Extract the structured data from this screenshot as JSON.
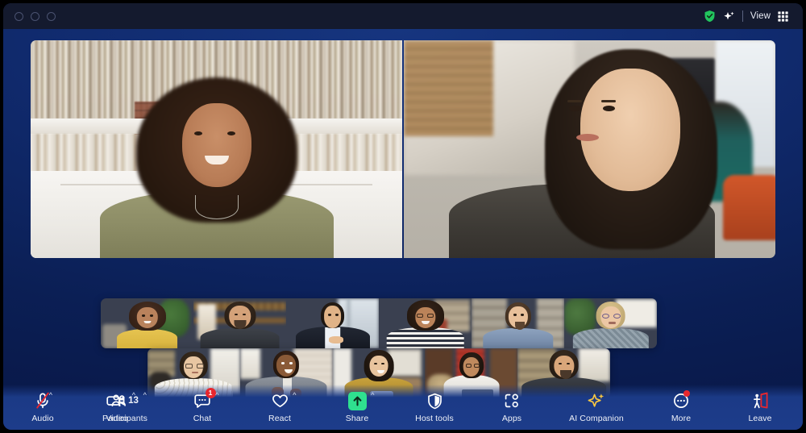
{
  "window": {
    "titlebar": {
      "traffic_lights": [
        "close",
        "minimize",
        "maximize"
      ],
      "encryption_icon": "shield-check-icon",
      "ai_icon": "sparkle-icon",
      "view_label": "View",
      "view_grid_icon": "grid-icon"
    }
  },
  "meeting": {
    "main_speakers": [
      {
        "name": "speaker-primary-left"
      },
      {
        "name": "speaker-primary-right"
      }
    ],
    "thumbnail_row_1": [
      {
        "name": "participant-thumb-1"
      },
      {
        "name": "participant-thumb-2"
      },
      {
        "name": "participant-thumb-3"
      },
      {
        "name": "participant-thumb-4"
      },
      {
        "name": "participant-thumb-5"
      },
      {
        "name": "participant-thumb-6"
      }
    ],
    "thumbnail_row_2": [
      {
        "name": "participant-thumb-7"
      },
      {
        "name": "participant-thumb-8"
      },
      {
        "name": "participant-thumb-9"
      },
      {
        "name": "participant-thumb-10"
      },
      {
        "name": "participant-thumb-11"
      }
    ]
  },
  "toolbar": {
    "audio": {
      "label": "Audio",
      "icon": "microphone-muted-icon",
      "muted": true,
      "caret": "^"
    },
    "video": {
      "label": "Video",
      "icon": "video-camera-icon",
      "caret": "^"
    },
    "participants": {
      "label": "Participants",
      "icon": "participants-icon",
      "count": "13",
      "caret": "^"
    },
    "chat": {
      "label": "Chat",
      "icon": "chat-bubble-icon",
      "badge": "1",
      "caret": "^"
    },
    "react": {
      "label": "React",
      "icon": "heart-icon",
      "caret": "^"
    },
    "share": {
      "label": "Share",
      "icon": "share-screen-arrow-icon",
      "caret": "^"
    },
    "host_tools": {
      "label": "Host tools",
      "icon": "shield-icon"
    },
    "apps": {
      "label": "Apps",
      "icon": "apps-icon"
    },
    "ai_companion": {
      "label": "AI Companion",
      "icon": "sparkle-icon"
    },
    "more": {
      "label": "More",
      "icon": "more-ellipsis-circle-icon",
      "badge_dot": true
    },
    "leave": {
      "label": "Leave",
      "icon": "leave-door-icon"
    }
  },
  "colors": {
    "titlebar_bg": "#141a2e",
    "stage_bg": "#0e2a70",
    "toolbar_bg": "#1d3c8a",
    "share_green": "#2fe08f",
    "badge_red": "#e8272e",
    "leave_red": "#e8272e",
    "ai_gold": "#f5c542",
    "encryption_green": "#22c55e",
    "text_light": "#eef1f8"
  }
}
